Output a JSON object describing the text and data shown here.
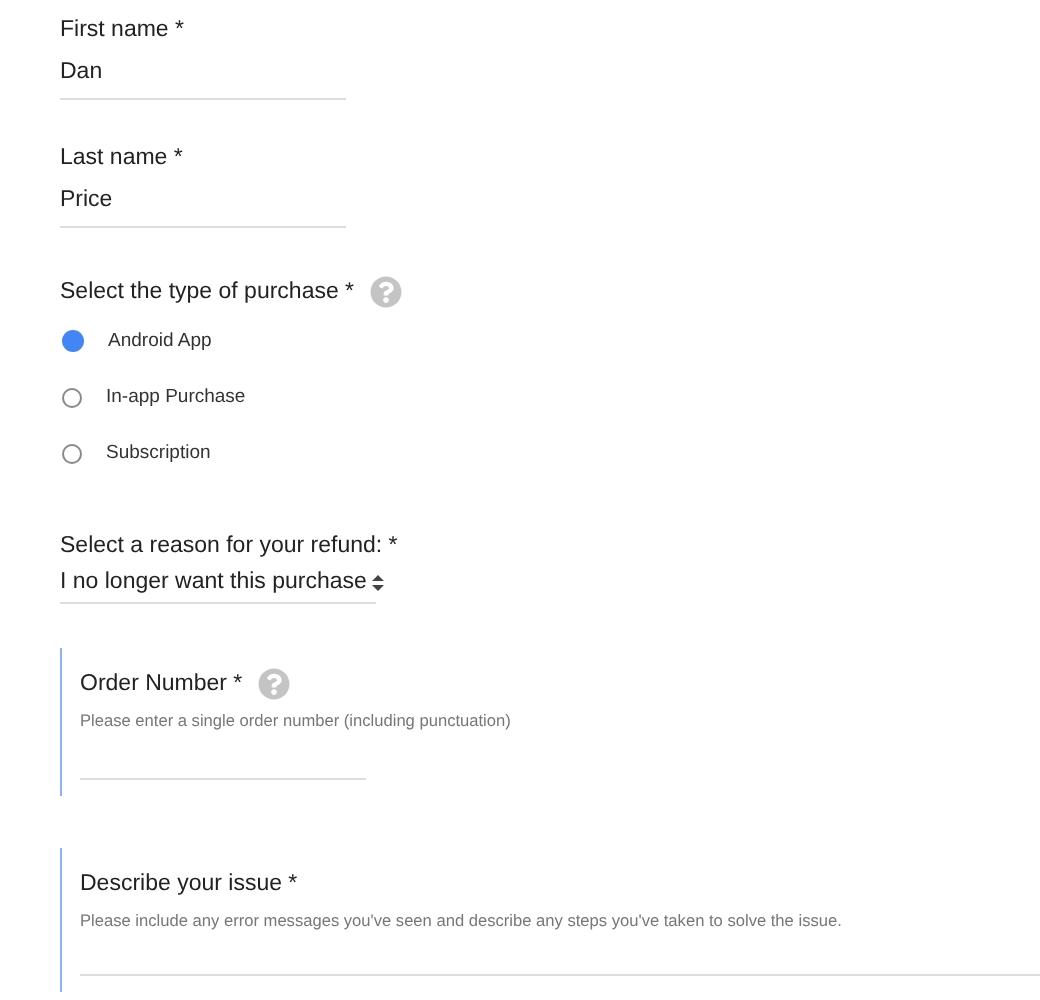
{
  "name_fields": [
    {
      "label": "First name *",
      "value": "Dan"
    },
    {
      "label": "Last name *",
      "value": "Price"
    }
  ],
  "purchase_type": {
    "label": "Select the type of purchase *",
    "help": true,
    "options": [
      {
        "label": "Android App",
        "selected": true
      },
      {
        "label": "In-app Purchase",
        "selected": false
      },
      {
        "label": "Subscription",
        "selected": false
      }
    ]
  },
  "refund_reason": {
    "label": "Select a reason for your refund: *",
    "value": "I no longer want this purchase"
  },
  "detail_fields": [
    {
      "kind": "short",
      "label": "Order Number *",
      "help": true,
      "hint": "Please enter a single order number (including punctuation)"
    },
    {
      "kind": "long",
      "label": "Describe your issue *",
      "help": false,
      "hint": "Please include any error messages you've seen and describe any steps you've taken to solve the issue."
    }
  ]
}
